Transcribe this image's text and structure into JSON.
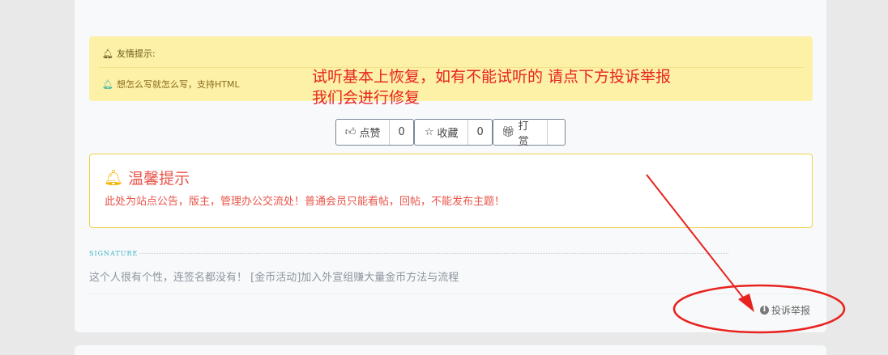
{
  "notice": {
    "title": "友情提示:",
    "body": "想怎么写就怎么写，支持HTML"
  },
  "annotation": {
    "line1": "试听基本上恢复，如有不能试听的 请点下方投诉举报",
    "line2": "我们会进行修复"
  },
  "actions": {
    "like_label": "点赞",
    "like_count": "0",
    "favorite_label": "收藏",
    "favorite_count": "0",
    "tip_label": "打赏"
  },
  "warm_tip": {
    "title": "温馨提示",
    "body": "此处为站点公告，版主，管理办公交流处！普通会员只能看帖，回帖，不能发布主题！"
  },
  "signature": {
    "label": "SIGNATURE",
    "text": "这个人很有个性，连签名都没有！ [金币活动]加入外宣组赚大量金币方法与流程"
  },
  "report": {
    "label": "投诉举报"
  },
  "colors": {
    "annotation_red": "#e8231f",
    "notice_bg": "#fdf0a7",
    "tip_border": "#f0d04c",
    "signature_accent": "#3ab2c7"
  }
}
